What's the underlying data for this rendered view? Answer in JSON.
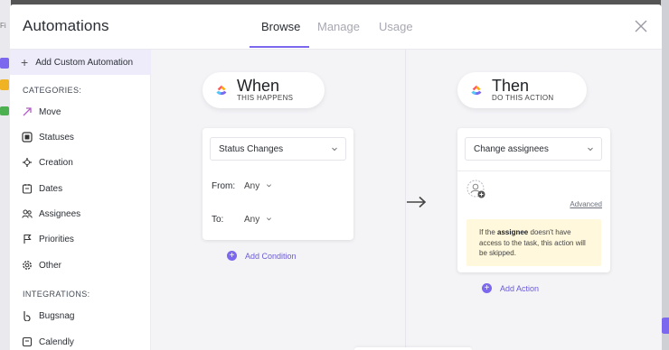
{
  "background": {
    "left_label": "Fi"
  },
  "header": {
    "title": "Automations",
    "tabs": [
      {
        "label": "Browse",
        "active": true
      },
      {
        "label": "Manage",
        "active": false
      },
      {
        "label": "Usage",
        "active": false
      }
    ],
    "close_icon": "close-icon"
  },
  "sidebar": {
    "add_custom_label": "Add Custom Automation",
    "categories_heading": "CATEGORIES:",
    "categories": [
      {
        "label": "Move",
        "icon": "move-arrow-icon"
      },
      {
        "label": "Statuses",
        "icon": "status-square-icon"
      },
      {
        "label": "Creation",
        "icon": "creation-plus-icon"
      },
      {
        "label": "Dates",
        "icon": "calendar-icon"
      },
      {
        "label": "Assignees",
        "icon": "people-icon"
      },
      {
        "label": "Priorities",
        "icon": "flag-icon"
      },
      {
        "label": "Other",
        "icon": "gear-icon"
      }
    ],
    "integrations_heading": "INTEGRATIONS:",
    "integrations": [
      {
        "label": "Bugsnag",
        "icon": "bugsnag-icon"
      },
      {
        "label": "Calendly",
        "icon": "calendly-icon"
      }
    ]
  },
  "when": {
    "title": "When",
    "subtitle": "THIS HAPPENS",
    "trigger_select": "Status Changes",
    "from_label": "From:",
    "from_value": "Any",
    "to_label": "To:",
    "to_value": "Any",
    "add_condition": "Add Condition"
  },
  "then": {
    "title": "Then",
    "subtitle": "DO THIS ACTION",
    "action_select": "Change assignees",
    "advanced_link": "Advanced",
    "notice_pre": "If the ",
    "notice_bold": "assignee",
    "notice_post": " doesn't have access to the task, this action will be skipped.",
    "add_action": "Add Action"
  },
  "colors": {
    "accent": "#7b68ee",
    "notice_bg": "#fff8dc",
    "sidebar_highlight": "#eeecfb"
  }
}
